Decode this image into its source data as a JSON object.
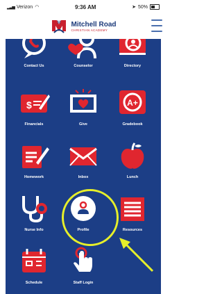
{
  "status_bar": {
    "carrier": "Verizon",
    "time": "9:36 AM",
    "battery": "50%",
    "battery_level": 0.5
  },
  "header": {
    "school_name": "Mitchell Road",
    "school_subtitle": "CHRISTIAN ACADEMY",
    "logo_letter": "M"
  },
  "tiles": [
    {
      "label": "Contact Us",
      "icon": "phone-bubble-icon"
    },
    {
      "label": "Counselor",
      "icon": "counselor-heart-icon"
    },
    {
      "label": "Directory",
      "icon": "directory-icon"
    },
    {
      "label": "Financials",
      "icon": "financials-icon"
    },
    {
      "label": "Give",
      "icon": "give-heart-money-icon"
    },
    {
      "label": "Gradebook",
      "icon": "gradebook-icon"
    },
    {
      "label": "Homework",
      "icon": "homework-icon"
    },
    {
      "label": "Inbox",
      "icon": "envelope-icon"
    },
    {
      "label": "Lunch",
      "icon": "apple-icon"
    },
    {
      "label": "Nurse Info",
      "icon": "stethoscope-icon"
    },
    {
      "label": "Profile",
      "icon": "profile-person-icon"
    },
    {
      "label": "Resources",
      "icon": "resources-icon"
    },
    {
      "label": "Schedule",
      "icon": "calendar-icon"
    },
    {
      "label": "Staff Login",
      "icon": "hand-pointer-icon"
    }
  ],
  "gradebook_glyph": "A+",
  "financials_glyph": "$",
  "colors": {
    "panel": "#1c3e86",
    "icon_red": "#e0262f",
    "highlight": "#e6ef2a",
    "brand_blue": "#1b3a7a"
  }
}
